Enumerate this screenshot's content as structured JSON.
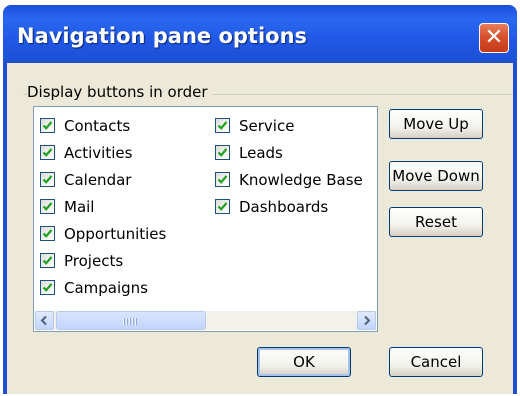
{
  "dialog": {
    "title": "Navigation pane options",
    "group_label": "Display buttons in order",
    "items_col1": [
      {
        "label": "Contacts",
        "checked": true
      },
      {
        "label": "Activities",
        "checked": true
      },
      {
        "label": "Calendar",
        "checked": true
      },
      {
        "label": "Mail",
        "checked": true
      },
      {
        "label": "Opportunities",
        "checked": true
      },
      {
        "label": "Projects",
        "checked": true
      },
      {
        "label": "Campaigns",
        "checked": true
      }
    ],
    "items_col2": [
      {
        "label": "Service",
        "checked": true
      },
      {
        "label": "Leads",
        "checked": true
      },
      {
        "label": "Knowledge Base",
        "checked": true
      },
      {
        "label": "Dashboards",
        "checked": true
      }
    ],
    "buttons": {
      "move_up": "Move Up",
      "move_down": "Move Down",
      "reset": "Reset",
      "ok": "OK",
      "cancel": "Cancel"
    },
    "icons": {
      "close": "close-icon",
      "check": "checkmark-icon",
      "scroll_left": "scroll-left-arrow-icon",
      "scroll_right": "scroll-right-arrow-icon"
    },
    "colors": {
      "titlebar": "#2a67f0",
      "client": "#ece9d8",
      "close_button": "#d8502d",
      "check": "#21a121"
    }
  }
}
